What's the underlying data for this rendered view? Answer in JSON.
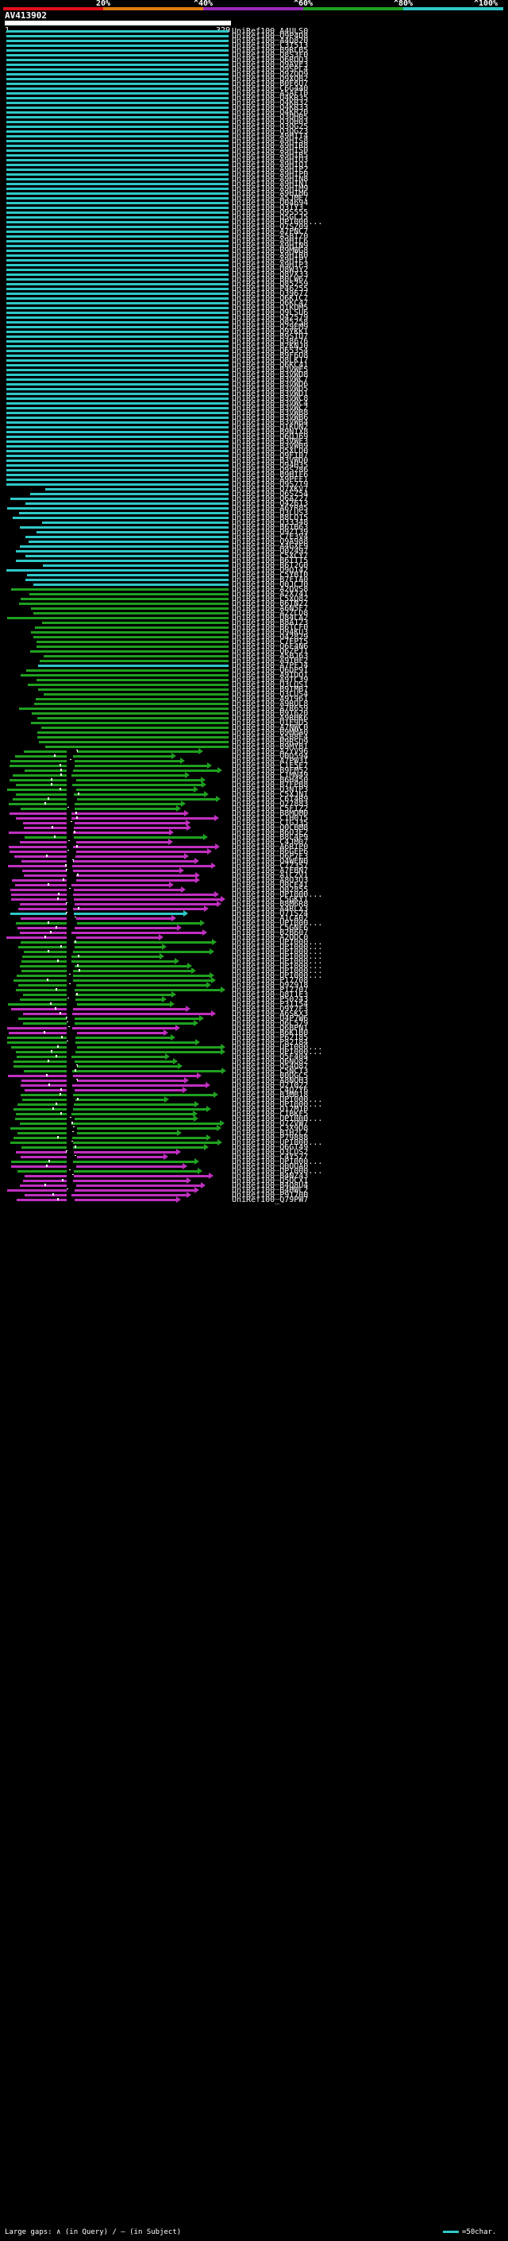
{
  "scale": {
    "labels": [
      "20%",
      "^40%",
      "^60%",
      "^80%",
      "^100%"
    ],
    "colors": [
      "#e0101a",
      "#e07a10",
      "#9a2ab8",
      "#20a020",
      "#30c8c8"
    ]
  },
  "query": {
    "name": "AV413902",
    "start": "1",
    "end": "329"
  },
  "palette": {
    "cyan": "#30c8c8",
    "green": "#20a020",
    "magenta": "#c030c0",
    "black": "#000000"
  },
  "hits": [
    {
      "id": "UniRef100_A4ULS0",
      "c": "cyan"
    },
    {
      "id": "UniRef100_Q9P4D8",
      "c": "cyan"
    },
    {
      "id": "UniRef100_A4Q820",
      "c": "cyan"
    },
    {
      "id": "UniRef100_C3T513",
      "c": "cyan"
    },
    {
      "id": "UniRef100_B9RLB5",
      "c": "cyan"
    },
    {
      "id": "UniRef100_Q8S3F0",
      "c": "cyan"
    },
    {
      "id": "UniRef100_Q6RUQ3",
      "c": "cyan"
    },
    {
      "id": "UniRef100_Q9AVE3",
      "c": "cyan"
    },
    {
      "id": "UniRef100_Q9SPL4",
      "c": "cyan"
    },
    {
      "id": "UniRef100_Q9ZQD9",
      "c": "cyan"
    },
    {
      "id": "UniRef100_Q9XQB2",
      "c": "cyan"
    },
    {
      "id": "UniRef100_B0F6U7",
      "c": "cyan"
    },
    {
      "id": "UniRef100_C6G440",
      "c": "cyan"
    },
    {
      "id": "UniRef100_A5AFT0",
      "c": "cyan"
    },
    {
      "id": "UniRef100_Q4KR35",
      "c": "cyan"
    },
    {
      "id": "UniRef100_Q4KR32",
      "c": "cyan"
    },
    {
      "id": "UniRef100_Q4KR33",
      "c": "cyan"
    },
    {
      "id": "UniRef100_Q4KR20",
      "c": "cyan"
    },
    {
      "id": "UniRef100_Q3QH05",
      "c": "cyan"
    },
    {
      "id": "UniRef100_Q3QH03",
      "c": "cyan"
    },
    {
      "id": "UniRef100_Q3QG25",
      "c": "cyan"
    },
    {
      "id": "UniRef100_Q3QGZ3",
      "c": "cyan"
    },
    {
      "id": "UniRef100_A9HIT4",
      "c": "cyan"
    },
    {
      "id": "UniRef100_A9HIS8",
      "c": "cyan"
    },
    {
      "id": "UniRef100_A9HIR8",
      "c": "cyan"
    },
    {
      "id": "UniRef100_A9HIS0",
      "c": "cyan"
    },
    {
      "id": "UniRef100_A9HIR5",
      "c": "cyan"
    },
    {
      "id": "UniRef100_A9HIQ3",
      "c": "cyan"
    },
    {
      "id": "UniRef100_A9HIQ1",
      "c": "cyan"
    },
    {
      "id": "UniRef100_A9HIP2",
      "c": "cyan"
    },
    {
      "id": "UniRef100_A9HIP0",
      "c": "cyan"
    },
    {
      "id": "UniRef100_A9HIN8",
      "c": "cyan"
    },
    {
      "id": "UniRef100_A9HIN1",
      "c": "cyan"
    },
    {
      "id": "UniRef100_A9HIM9",
      "c": "cyan"
    },
    {
      "id": "UniRef100_A9HIM6",
      "c": "cyan"
    },
    {
      "id": "UniRef100_A5JME7",
      "c": "cyan"
    },
    {
      "id": "UniRef100_Q04694",
      "c": "cyan"
    },
    {
      "id": "UniRef100_Q3IY3",
      "c": "cyan"
    },
    {
      "id": "UniRef100_Q9S555",
      "c": "cyan"
    },
    {
      "id": "UniRef100_Q5GLJ5",
      "c": "cyan"
    },
    {
      "id": "UniRef100_UPI000...",
      "c": "cyan"
    },
    {
      "id": "UniRef100_Q7SZ09",
      "c": "cyan"
    },
    {
      "id": "UniRef100_A7PNC7",
      "c": "cyan"
    },
    {
      "id": "UniRef100_A5BTZ0",
      "c": "cyan"
    },
    {
      "id": "UniRef100_A9HIL6",
      "c": "cyan"
    },
    {
      "id": "UniRef100_A9HIN9",
      "c": "cyan"
    },
    {
      "id": "UniRef100_B9MWG8",
      "c": "cyan"
    },
    {
      "id": "UniRef100_A9HIR0",
      "c": "cyan"
    },
    {
      "id": "UniRef100_A9HIP1",
      "c": "cyan"
    },
    {
      "id": "UniRef100_A9HIP3",
      "c": "cyan"
    },
    {
      "id": "UniRef100_Q8W3Y2",
      "c": "cyan"
    },
    {
      "id": "UniRef100_Q8VX33",
      "c": "cyan"
    },
    {
      "id": "UniRef100_B0LW67",
      "c": "cyan"
    },
    {
      "id": "UniRef100_Q85259",
      "c": "cyan"
    },
    {
      "id": "UniRef100_P46255",
      "c": "cyan"
    },
    {
      "id": "UniRef100_Q39677",
      "c": "cyan"
    },
    {
      "id": "UniRef100_Q6K1C7",
      "c": "cyan"
    },
    {
      "id": "UniRef100_Q6KC47",
      "c": "cyan"
    },
    {
      "id": "UniRef100_Q1KUM5",
      "c": "cyan"
    },
    {
      "id": "UniRef100_Q9LSU6",
      "c": "cyan"
    },
    {
      "id": "UniRef100_Q42579",
      "c": "cyan"
    },
    {
      "id": "UniRef100_Q85258",
      "c": "cyan"
    },
    {
      "id": "UniRef100_Q29EM9",
      "c": "cyan"
    },
    {
      "id": "UniRef100_Q9YKK1",
      "c": "cyan"
    },
    {
      "id": "UniRef100_B9SID7",
      "c": "cyan"
    },
    {
      "id": "UniRef100_Q38676",
      "c": "cyan"
    },
    {
      "id": "UniRef100_B2KNJ0",
      "c": "cyan"
    },
    {
      "id": "UniRef100_Q65354",
      "c": "cyan"
    },
    {
      "id": "UniRef100_B9F6U8",
      "c": "cyan"
    },
    {
      "id": "UniRef100_Q8LK17",
      "c": "cyan"
    },
    {
      "id": "UniRef100_Q6KC41",
      "c": "cyan"
    },
    {
      "id": "UniRef100_B3VWE5",
      "c": "cyan"
    },
    {
      "id": "UniRef100_B3VWD8",
      "c": "cyan"
    },
    {
      "id": "UniRef100_B3VWC7",
      "c": "cyan"
    },
    {
      "id": "UniRef100_B3VWD6",
      "c": "cyan"
    },
    {
      "id": "UniRef100_B3VWD5",
      "c": "cyan"
    },
    {
      "id": "UniRef100_B3VWD1",
      "c": "cyan"
    },
    {
      "id": "UniRef100_B3VWC8",
      "c": "cyan"
    },
    {
      "id": "UniRef100_B3VWC4",
      "c": "cyan"
    },
    {
      "id": "UniRef100_B3VWC2",
      "c": "cyan"
    },
    {
      "id": "UniRef100_B3VWB8",
      "c": "cyan"
    },
    {
      "id": "UniRef100_B3VWB6",
      "c": "cyan"
    },
    {
      "id": "UniRef100_B3VWB4",
      "c": "cyan"
    },
    {
      "id": "UniRef100_Q1KUN2",
      "c": "cyan"
    },
    {
      "id": "UniRef100_B9NIX8",
      "c": "cyan"
    },
    {
      "id": "UniRef100_Q6QJ69",
      "c": "cyan"
    },
    {
      "id": "UniRef100_B3VWE3",
      "c": "cyan"
    },
    {
      "id": "UniRef100_B3VWB9",
      "c": "cyan"
    },
    {
      "id": "UniRef100_Q5XLD0",
      "c": "cyan"
    },
    {
      "id": "UniRef100_Q9FI07",
      "c": "cyan"
    },
    {
      "id": "UniRef100_B3VWD0",
      "c": "cyan"
    },
    {
      "id": "UniRef100_Q94H35",
      "c": "cyan"
    },
    {
      "id": "UniRef100_Q9S286",
      "c": "cyan"
    },
    {
      "id": "UniRef100_B9HIF6",
      "c": "cyan"
    },
    {
      "id": "UniRef100_A9PFF1",
      "c": "cyan"
    },
    {
      "id": "UniRef100_Q9S7T9",
      "c": "cyan"
    },
    {
      "id": "UniRef100_Q7XKV7",
      "c": "cyan"
    },
    {
      "id": "UniRef100_Q6SZ54",
      "c": "cyan"
    },
    {
      "id": "UniRef100_Q6AZ27",
      "c": "cyan"
    },
    {
      "id": "UniRef100_Q42613",
      "c": "cyan"
    },
    {
      "id": "UniRef100_A6YR85",
      "c": "cyan"
    },
    {
      "id": "UniRef100_Q3LUS3",
      "c": "cyan"
    },
    {
      "id": "UniRef100_B8LQ15",
      "c": "cyan"
    },
    {
      "id": "UniRef100_Q33348",
      "c": "cyan"
    },
    {
      "id": "UniRef100_B6TB63",
      "c": "cyan"
    },
    {
      "id": "UniRef100_Q9ZT39",
      "c": "cyan"
    },
    {
      "id": "UniRef100_C7E3V4",
      "c": "cyan"
    },
    {
      "id": "UniRef100_Q9A988",
      "c": "cyan"
    },
    {
      "id": "UniRef100_A4GXE9",
      "c": "cyan"
    },
    {
      "id": "UniRef100_Q02497",
      "c": "cyan"
    },
    {
      "id": "UniRef100_C5XCY7",
      "c": "cyan"
    },
    {
      "id": "UniRef100_B6TTT5",
      "c": "cyan"
    },
    {
      "id": "UniRef100_B6T2G0",
      "c": "cyan"
    },
    {
      "id": "UniRef100_Q9Q142",
      "c": "cyan"
    },
    {
      "id": "UniRef100_C5YBI0",
      "c": "cyan"
    },
    {
      "id": "UniRef100_B7FIA0",
      "c": "cyan"
    },
    {
      "id": "UniRef100_Q0JCJ0",
      "c": "cyan"
    },
    {
      "id": "UniRef100_A2QVS8",
      "c": "green"
    },
    {
      "id": "UniRef100_A2X741",
      "c": "green"
    },
    {
      "id": "UniRef100_C5XQ82",
      "c": "green"
    },
    {
      "id": "UniRef100_B6TN27",
      "c": "green"
    },
    {
      "id": "UniRef100_A6N5F7",
      "c": "green"
    },
    {
      "id": "UniRef100_A2ZLD8",
      "c": "green"
    },
    {
      "id": "UniRef100_Q84LA2",
      "c": "green"
    },
    {
      "id": "UniRef100_B8A123",
      "c": "green"
    },
    {
      "id": "UniRef100_B6TCF0",
      "c": "green"
    },
    {
      "id": "UniRef100_Q94KU3",
      "c": "green"
    },
    {
      "id": "UniRef100_Q42829",
      "c": "green"
    },
    {
      "id": "UniRef100_C7EPT5",
      "c": "green"
    },
    {
      "id": "UniRef100_Q6F4N6",
      "c": "green"
    },
    {
      "id": "UniRef100_Q6ZPJ1",
      "c": "green"
    },
    {
      "id": "UniRef100_A5BJ63",
      "c": "green"
    },
    {
      "id": "UniRef100_A9THF2",
      "c": "green"
    },
    {
      "id": "UniRef100_A7PFJ4",
      "c": "cyan"
    },
    {
      "id": "UniRef100_Q6DP91",
      "c": "green"
    },
    {
      "id": "UniRef100_A9TDQ1",
      "c": "green"
    },
    {
      "id": "UniRef100_A9TC39",
      "c": "green"
    },
    {
      "id": "UniRef100_Q3LUS1",
      "c": "green"
    },
    {
      "id": "UniRef100_B9IMB7",
      "c": "green"
    },
    {
      "id": "UniRef100_Q3LUS4",
      "c": "green"
    },
    {
      "id": "UniRef100_A9T961",
      "c": "green"
    },
    {
      "id": "UniRef100_A9RUL8",
      "c": "green"
    },
    {
      "id": "UniRef100_A7R659",
      "c": "green"
    },
    {
      "id": "UniRef100_B9T620",
      "c": "green"
    },
    {
      "id": "UniRef100_A9RHK6",
      "c": "green"
    },
    {
      "id": "UniRef100_Q1E9D5",
      "c": "green"
    },
    {
      "id": "UniRef100_A7NWC0",
      "c": "green"
    },
    {
      "id": "UniRef100_B9MMA0",
      "c": "green"
    },
    {
      "id": "UniRef100_A5B8E4",
      "c": "green"
    },
    {
      "id": "UniRef100_B9RSU9",
      "c": "green"
    },
    {
      "id": "UniRef100_B9MYB1",
      "c": "green"
    },
    {
      "id": "UniRef100_A2YV96",
      "c": "green"
    },
    {
      "id": "UniRef100_Q0D594",
      "c": "green"
    },
    {
      "id": "UniRef100_A7PW3I",
      "c": "green"
    },
    {
      "id": "UniRef100_C1E5E7",
      "c": "green"
    },
    {
      "id": "UniRef100_B9FM52",
      "c": "green"
    },
    {
      "id": "UniRef100_C1MN49",
      "c": "green"
    },
    {
      "id": "UniRef100_B6H450",
      "c": "green"
    },
    {
      "id": "UniRef100_B7FPB8",
      "c": "green"
    },
    {
      "id": "UniRef100_Q3NTP3",
      "c": "green"
    },
    {
      "id": "UniRef100_C5XJN1",
      "c": "green"
    },
    {
      "id": "UniRef100_C6T4R9",
      "c": "green"
    },
    {
      "id": "UniRef100_Q27883",
      "c": "green"
    },
    {
      "id": "UniRef100_C5FIZ2",
      "c": "green"
    },
    {
      "id": "UniRef100_B8MDM0",
      "c": "magenta"
    },
    {
      "id": "UniRef100_C1H015",
      "c": "magenta"
    },
    {
      "id": "UniRef100_C1GJ35",
      "c": "magenta"
    },
    {
      "id": "UniRef100_Q0CBM8",
      "c": "magenta"
    },
    {
      "id": "UniRef100_B6Q3E2",
      "c": "magenta"
    },
    {
      "id": "UniRef100_B8L4P9",
      "c": "green"
    },
    {
      "id": "UniRef100_C4JM07",
      "c": "magenta"
    },
    {
      "id": "UniRef100_A6RIP0",
      "c": "magenta"
    },
    {
      "id": "UniRef100_B6GFP6",
      "c": "magenta"
    },
    {
      "id": "UniRef100_Q6P7E3",
      "c": "magenta"
    },
    {
      "id": "UniRef100_Q4WEN0",
      "c": "magenta"
    },
    {
      "id": "UniRef100_C7Z357",
      "c": "magenta"
    },
    {
      "id": "UniRef100_A7EBN7",
      "c": "magenta"
    },
    {
      "id": "UniRef100_A1CZV1",
      "c": "magenta"
    },
    {
      "id": "UniRef100_A8Q3U3",
      "c": "magenta"
    },
    {
      "id": "UniRef100_Q0CE41",
      "c": "magenta"
    },
    {
      "id": "UniRef100_Q02855",
      "c": "magenta"
    },
    {
      "id": "UniRef100_UPI000...",
      "c": "magenta"
    },
    {
      "id": "UniRef100_C5GKY1",
      "c": "magenta"
    },
    {
      "id": "UniRef100_B8M6R8",
      "c": "magenta"
    },
    {
      "id": "UniRef100_A4RLX3",
      "c": "magenta"
    },
    {
      "id": "UniRef100_Q71S24",
      "c": "cyan"
    },
    {
      "id": "UniRef100_A1CA02",
      "c": "magenta"
    },
    {
      "id": "UniRef100_UPI000...",
      "c": "green"
    },
    {
      "id": "UniRef100_C5GNF6",
      "c": "magenta"
    },
    {
      "id": "UniRef100_B2B607",
      "c": "magenta"
    },
    {
      "id": "UniRef100_A2QDC0",
      "c": "magenta"
    },
    {
      "id": "UniRef100_UPI000...",
      "c": "green"
    },
    {
      "id": "UniRef100_UPI000...",
      "c": "green"
    },
    {
      "id": "UniRef100_UPI000...",
      "c": "green"
    },
    {
      "id": "UniRef100_UPI000...",
      "c": "green"
    },
    {
      "id": "UniRef100_UPI000...",
      "c": "green"
    },
    {
      "id": "UniRef100_UPI000...",
      "c": "green"
    },
    {
      "id": "UniRef100_UPI000...",
      "c": "green"
    },
    {
      "id": "UniRef100_UPI000...",
      "c": "green"
    },
    {
      "id": "UniRef100_P17708",
      "c": "green"
    },
    {
      "id": "UniRef100_Q9Z918",
      "c": "green"
    },
    {
      "id": "UniRef100_P17707",
      "c": "green"
    },
    {
      "id": "UniRef100_Q8T1E3",
      "c": "green"
    },
    {
      "id": "UniRef100_P50243",
      "c": "green"
    },
    {
      "id": "UniRef100_P31154",
      "c": "green"
    },
    {
      "id": "UniRef100_Q9Y7F3",
      "c": "magenta"
    },
    {
      "id": "UniRef100_A6SKX3",
      "c": "magenta"
    },
    {
      "id": "UniRef100_Q4P7W6",
      "c": "green"
    },
    {
      "id": "UniRef100_Q6C579",
      "c": "green"
    },
    {
      "id": "UniRef100_Q6BPN1",
      "c": "magenta"
    },
    {
      "id": "UniRef100_B6K1B0",
      "c": "magenta"
    },
    {
      "id": "UniRef100_P62185",
      "c": "green"
    },
    {
      "id": "UniRef100_P82184",
      "c": "green"
    },
    {
      "id": "UniRef100_UPI000...",
      "c": "green"
    },
    {
      "id": "UniRef100_UPI000...",
      "c": "green"
    },
    {
      "id": "UniRef100_Q5F404",
      "c": "green"
    },
    {
      "id": "UniRef100_Q6NQ82",
      "c": "green"
    },
    {
      "id": "UniRef100_Q54Q87",
      "c": "green"
    },
    {
      "id": "UniRef100_C5NCT3",
      "c": "green"
    },
    {
      "id": "UniRef100_B0DGC5",
      "c": "magenta"
    },
    {
      "id": "UniRef100_A8NQH3",
      "c": "magenta"
    },
    {
      "id": "UniRef100_Q21022",
      "c": "magenta"
    },
    {
      "id": "UniRef100_C4QZY6",
      "c": "magenta"
    },
    {
      "id": "UniRef100_B3MB18",
      "c": "green"
    },
    {
      "id": "UniRef100_UPI000...",
      "c": "green"
    },
    {
      "id": "UniRef100_UPI000...",
      "c": "green"
    },
    {
      "id": "UniRef100_Q17M10",
      "c": "green"
    },
    {
      "id": "UniRef100_C1BKF5",
      "c": "green"
    },
    {
      "id": "UniRef100_UPI000...",
      "c": "green"
    },
    {
      "id": "UniRef100_Q7ZVW7",
      "c": "green"
    },
    {
      "id": "UniRef100_C3X9D8",
      "c": "green"
    },
    {
      "id": "UniRef100_B1H2L2",
      "c": "green"
    },
    {
      "id": "UniRef100_P79888",
      "c": "green"
    },
    {
      "id": "UniRef100_UPI000...",
      "c": "green"
    },
    {
      "id": "UniRef100_Q6GT49",
      "c": "green"
    },
    {
      "id": "UniRef100_Q3LUS2",
      "c": "magenta"
    },
    {
      "id": "UniRef100_C4Y527",
      "c": "magenta"
    },
    {
      "id": "UniRef100_UPI000...",
      "c": "green"
    },
    {
      "id": "UniRef100_Q0UUA0",
      "c": "magenta"
    },
    {
      "id": "UniRef100_UPI000...",
      "c": "green"
    },
    {
      "id": "UniRef100_B4NZ43",
      "c": "magenta"
    },
    {
      "id": "UniRef100_Q5QCX1",
      "c": "magenta"
    },
    {
      "id": "UniRef100_B4Q8U4",
      "c": "magenta"
    },
    {
      "id": "UniRef100_B4HWL2",
      "c": "magenta"
    },
    {
      "id": "UniRef100_P91700",
      "c": "magenta"
    },
    {
      "id": "UniRef100_Q79PW7",
      "c": "magenta"
    }
  ],
  "legend": {
    "text": "Large gaps: ∧ (in Query) / – (in Subject)",
    "right": "=50char."
  }
}
